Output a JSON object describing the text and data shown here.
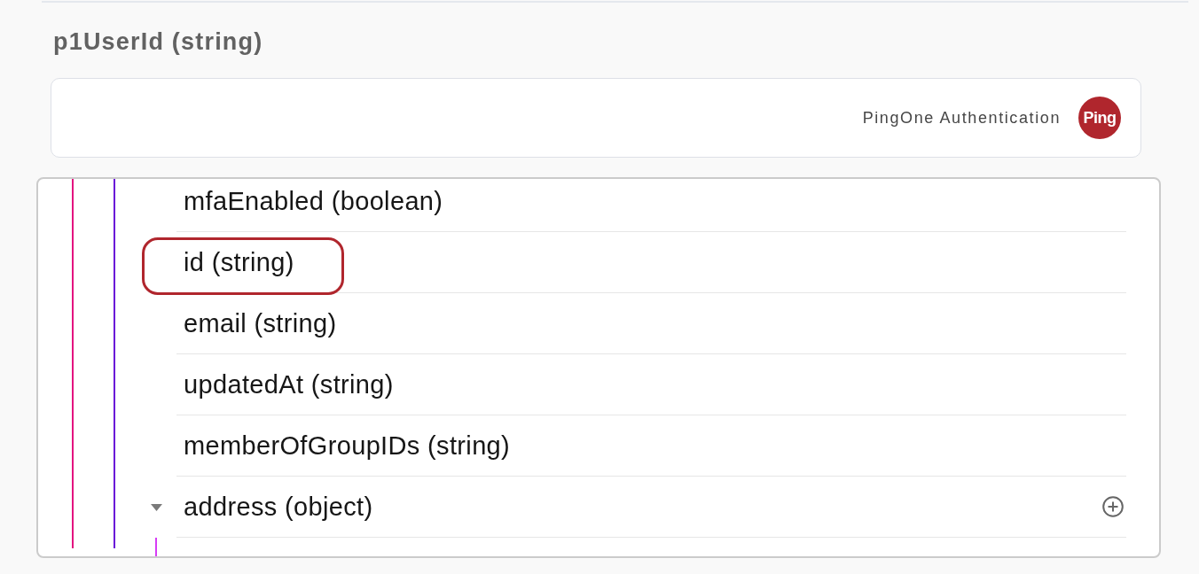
{
  "header": {
    "title": "p1UserId (string)"
  },
  "mapping_field": {
    "source": "PingOne Authentication",
    "logo_text": "Ping"
  },
  "tree": {
    "fields": [
      {
        "label": "mfaEnabled (boolean)",
        "kind": "field",
        "highlighted": false
      },
      {
        "label": "id (string)",
        "kind": "field",
        "highlighted": true
      },
      {
        "label": "email (string)",
        "kind": "field",
        "highlighted": false
      },
      {
        "label": "updatedAt (string)",
        "kind": "field",
        "highlighted": false
      },
      {
        "label": "memberOfGroupIDs (string)",
        "kind": "field",
        "highlighted": false
      },
      {
        "label": "address (object)",
        "kind": "object",
        "expanded": true,
        "highlighted": false
      }
    ]
  }
}
